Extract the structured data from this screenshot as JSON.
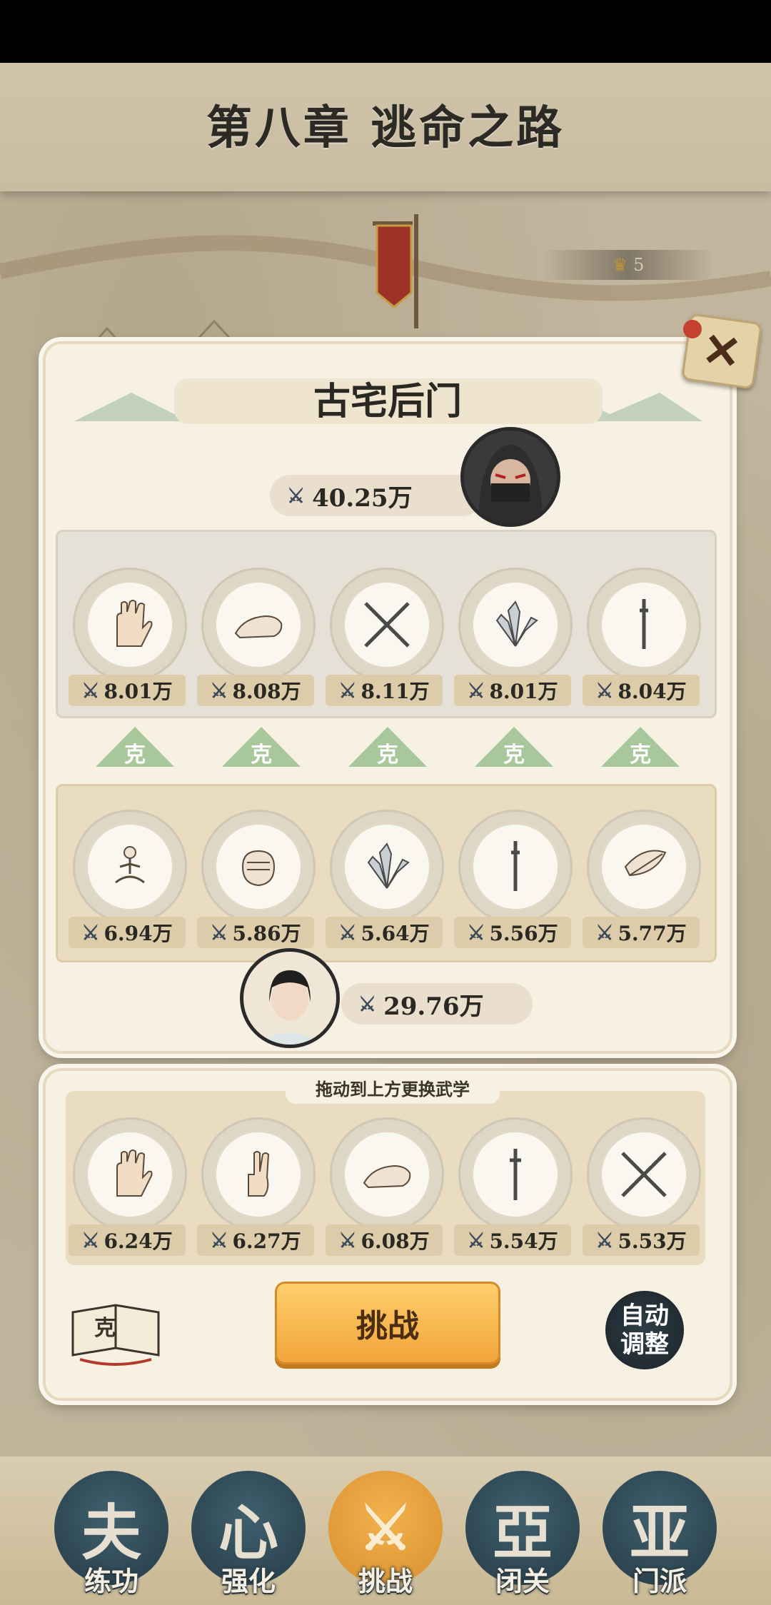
{
  "header": {
    "chapter_title": "第八章 逃命之路",
    "rank": "5"
  },
  "battle": {
    "title": "古宅后门",
    "enemy": {
      "power": "40.25万",
      "skills": [
        {
          "icon": "palm-icon",
          "power": "8.01万"
        },
        {
          "icon": "shoe-icon",
          "power": "8.08万"
        },
        {
          "icon": "crossed-spears-icon",
          "power": "8.11万"
        },
        {
          "icon": "throwing-knives-icon",
          "power": "8.01万"
        },
        {
          "icon": "saber-icon",
          "power": "8.04万"
        }
      ]
    },
    "counter_label": "克",
    "player": {
      "power": "29.76万",
      "skills": [
        {
          "icon": "meditation-icon",
          "power": "6.94万"
        },
        {
          "icon": "fist-icon",
          "power": "5.86万"
        },
        {
          "icon": "throwing-knives-icon",
          "power": "5.64万"
        },
        {
          "icon": "saber-icon",
          "power": "5.56万"
        },
        {
          "icon": "feather-icon",
          "power": "5.77万"
        }
      ]
    }
  },
  "bench": {
    "hint": "拖动到上方更换武学",
    "skills": [
      {
        "icon": "palm-icon",
        "power": "6.24万"
      },
      {
        "icon": "two-finger-icon",
        "power": "6.27万"
      },
      {
        "icon": "shoe-icon",
        "power": "6.08万"
      },
      {
        "icon": "sword-icon",
        "power": "5.54万"
      },
      {
        "icon": "crossed-spears-icon",
        "power": "5.53万"
      }
    ],
    "challenge_label": "挑战",
    "auto_label": "自动调整",
    "book_label": "克"
  },
  "nav": [
    {
      "label": "练功",
      "glyph": "夫",
      "active": false
    },
    {
      "label": "强化",
      "glyph": "心",
      "active": false
    },
    {
      "label": "挑战",
      "glyph": "⚔",
      "active": true
    },
    {
      "label": "闭关",
      "glyph": "亞",
      "active": false
    },
    {
      "label": "门派",
      "glyph": "亚",
      "active": false
    }
  ],
  "colors": {
    "accent": "#f1a43a",
    "counter": "#a8c79a",
    "nav_disc": "#2f4a56"
  }
}
